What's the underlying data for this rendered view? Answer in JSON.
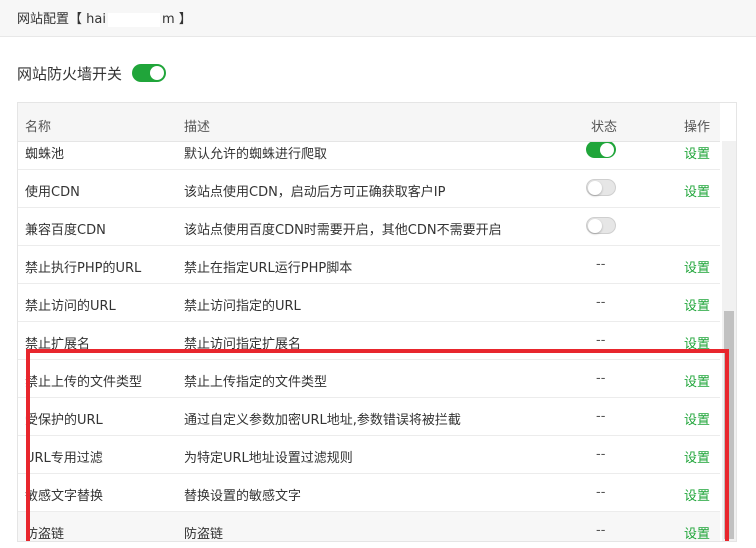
{
  "title": {
    "prefix": "网站配置【 hai",
    "suffix": "m 】"
  },
  "firewall_switch": {
    "label": "网站防火墙开关",
    "state": "on"
  },
  "table": {
    "headers": {
      "name": "名称",
      "desc": "描述",
      "status": "状态",
      "op": "操作"
    },
    "rows": [
      {
        "name": "蜘蛛池",
        "desc": "默认允许的蜘蛛进行爬取",
        "status": "toggle-on",
        "op": "设置"
      },
      {
        "name": "使用CDN",
        "desc": "该站点使用CDN，启动后方可正确获取客户IP",
        "status": "toggle-off",
        "op": "设置"
      },
      {
        "name": "兼容百度CDN",
        "desc": "该站点使用百度CDN时需要开启，其他CDN不需要开启",
        "status": "toggle-off",
        "op": ""
      },
      {
        "name": "禁止执行PHP的URL",
        "desc": "禁止在指定URL运行PHP脚本",
        "status": "--",
        "op": "设置"
      },
      {
        "name": "禁止访问的URL",
        "desc": "禁止访问指定的URL",
        "status": "--",
        "op": "设置"
      },
      {
        "name": "禁止扩展名",
        "desc": "禁止访问指定扩展名",
        "status": "--",
        "op": "设置"
      },
      {
        "name": "禁止上传的文件类型",
        "desc": "禁止上传指定的文件类型",
        "status": "--",
        "op": "设置"
      },
      {
        "name": "受保护的URL",
        "desc": "通过自定义参数加密URL地址,参数错误将被拦截",
        "status": "--",
        "op": "设置"
      },
      {
        "name": "URL专用过滤",
        "desc": "为特定URL地址设置过滤规则",
        "status": "--",
        "op": "设置"
      },
      {
        "name": "敏感文字替换",
        "desc": "替换设置的敏感文字",
        "status": "--",
        "op": "设置"
      },
      {
        "name": "防盗链",
        "desc": "防盗链",
        "status": "--",
        "op": "设置"
      }
    ]
  },
  "colors": {
    "accent": "#20a53a",
    "highlight": "#e8262d"
  }
}
